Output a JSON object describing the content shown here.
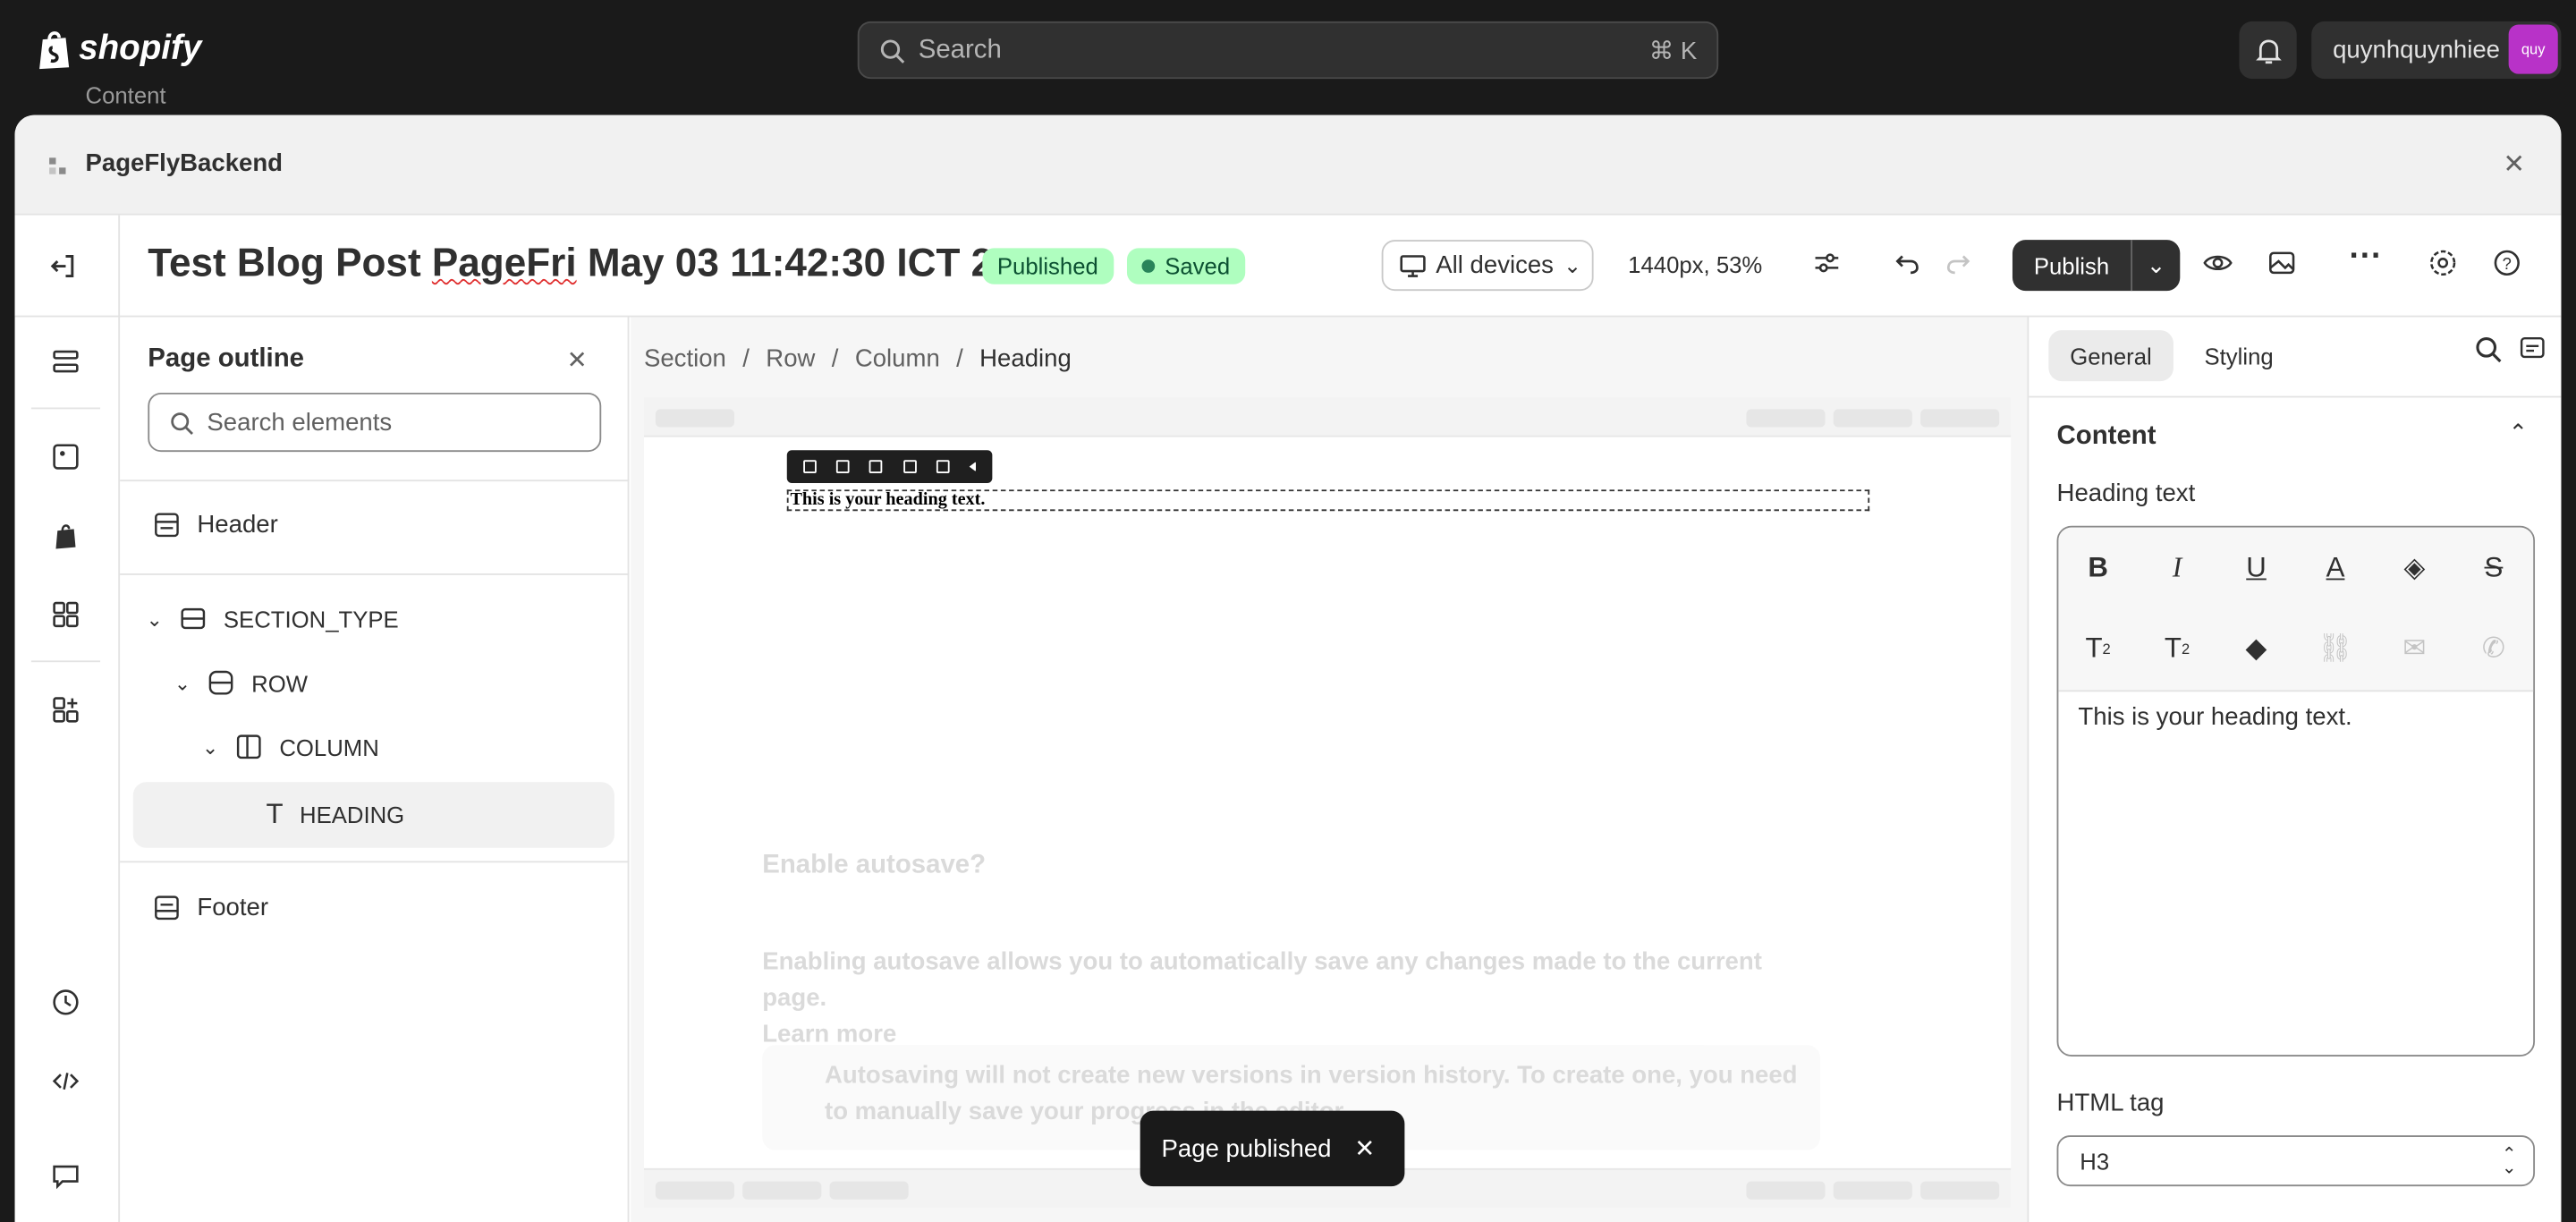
{
  "topbar": {
    "brand": "shopify",
    "search_placeholder": "Search",
    "search_shortcut": "⌘ K",
    "username": "quynhquynhiee",
    "avatar_initials": "quy",
    "behind_label": "Content"
  },
  "modal": {
    "app_name": "PageFlyBackend"
  },
  "toolbar": {
    "page_title_pre": "Test Blog Post ",
    "page_title_mis": "PageFri",
    "page_title_post": " May 03 11:42:30 ICT 2...",
    "status_published": "Published",
    "status_saved": "Saved",
    "device_select": "All devices",
    "zoom": "1440px, 53%",
    "publish_label": "Publish"
  },
  "outline": {
    "title": "Page outline",
    "search_placeholder": "Search elements",
    "header": "Header",
    "section": "SECTION_TYPE",
    "row": "ROW",
    "column": "COLUMN",
    "heading": "HEADING",
    "footer": "Footer"
  },
  "canvas": {
    "breadcrumb": [
      "Section",
      "Row",
      "Column",
      "Heading"
    ],
    "heading_text": "This is your heading text.",
    "ghost_title": "Enable autosave?",
    "ghost_body": "Enabling autosave allows you to automatically save any changes made to the current page.",
    "ghost_link": "Learn more",
    "ghost_warning": "Autosaving will not create new versions in version history. To create one, you need to manually save your progress in the editor."
  },
  "toast": {
    "message": "Page published"
  },
  "panel": {
    "tab_general": "General",
    "tab_styling": "Styling",
    "content_title": "Content",
    "heading_text_label": "Heading text",
    "editor_value": "This is your heading text.",
    "html_tag_label": "HTML tag",
    "html_tag_value": "H3"
  },
  "colors": {
    "topbar_bg": "#1a1a1a",
    "publish_bg": "#303030",
    "published_badge": "#affebf",
    "avatar": "#b832c8"
  }
}
